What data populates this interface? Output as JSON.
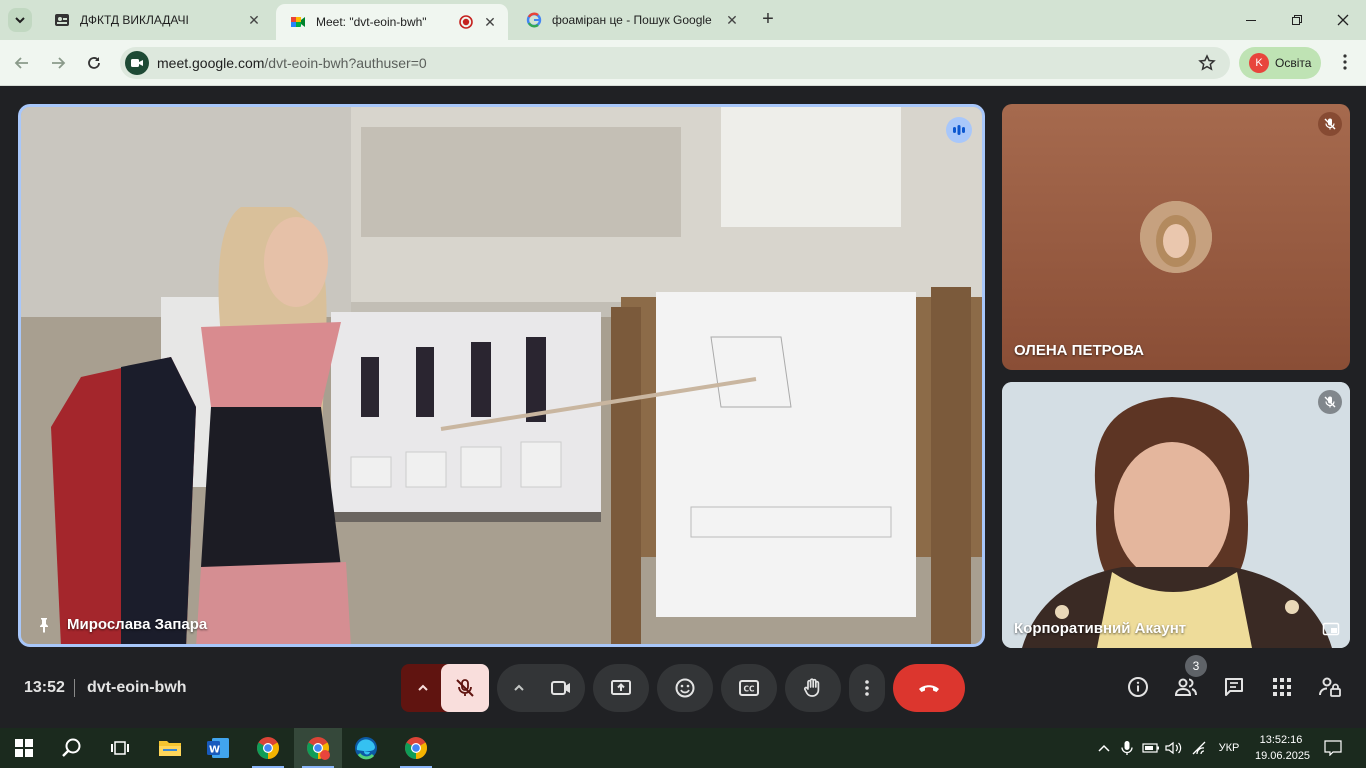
{
  "browser": {
    "tabs": [
      {
        "title": "ДФКТД ВИКЛАДАЧІ",
        "active": false
      },
      {
        "title": "Meet: \"dvt-eoin-bwh\"",
        "active": true,
        "recording": true
      },
      {
        "title": "фоаміран це - Пошук Google",
        "active": false
      }
    ],
    "url_host": "meet.google.com",
    "url_path": "/dvt-eoin-bwh?authuser=0",
    "profile": {
      "initial": "K",
      "name": "Освіта"
    }
  },
  "meet": {
    "main_participant": {
      "name": "Мирослава Запара",
      "pinned": true,
      "speaking": true
    },
    "participants": [
      {
        "name": "ОЛЕНА ПЕТРОВА",
        "muted": true,
        "camera_off": true
      },
      {
        "name": "Корпоративний Акаунт",
        "muted": true
      }
    ],
    "time": "13:52",
    "meeting_code": "dvt-eoin-bwh",
    "people_count": "3"
  },
  "taskbar": {
    "language": "УКР",
    "time": "13:52:16",
    "date": "19.06.2025"
  },
  "colors": {
    "end_call": "#dc362e",
    "mic_muted_bg": "#f9dedc",
    "mic_muted_group": "#601410",
    "accent_border": "#a8c7fa"
  }
}
